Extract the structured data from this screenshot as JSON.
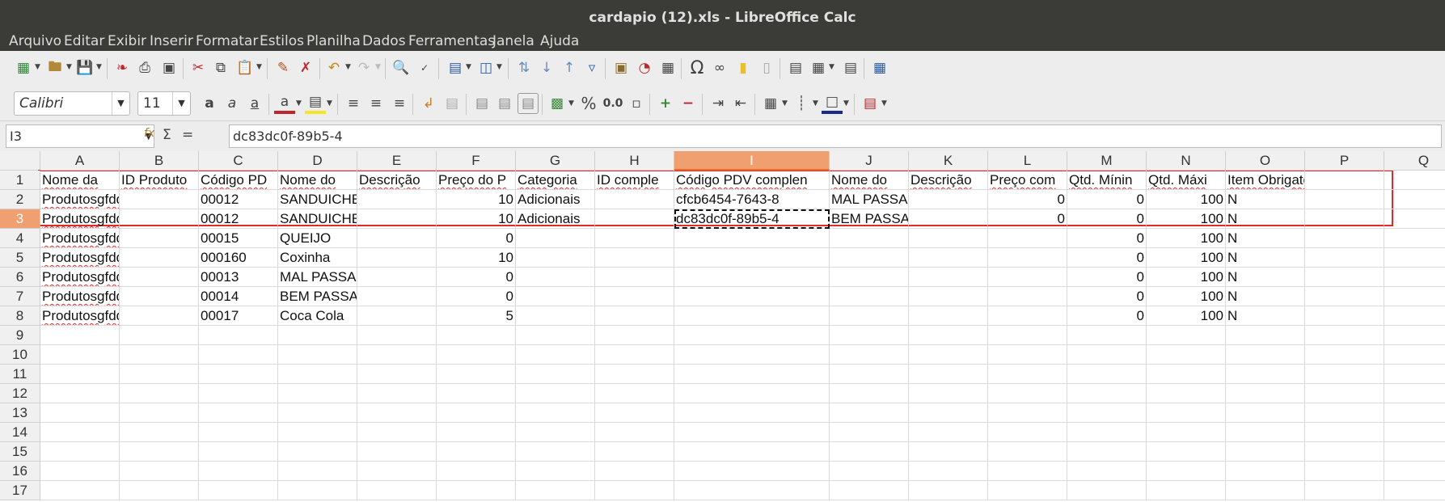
{
  "window": {
    "title": "cardapio (12).xls - LibreOffice Calc"
  },
  "menu": [
    "Arquivo",
    "Editar",
    "Exibir",
    "Inserir",
    "Formatar",
    "Estilos",
    "Planilha",
    "Dados",
    "Ferramentas",
    "Janela",
    "Ajuda"
  ],
  "toolbar": {
    "font_name": "Calibri",
    "font_size": "11",
    "percent_label": "%",
    "number_format_label": "0.0"
  },
  "formula_bar": {
    "cell_ref": "I3",
    "content": "dc83dc0f-89b5-4"
  },
  "sheet": {
    "columns": [
      "A",
      "B",
      "C",
      "D",
      "E",
      "F",
      "G",
      "H",
      "I",
      "J",
      "K",
      "L",
      "M",
      "N",
      "O",
      "P",
      "Q"
    ],
    "selected_column": "I",
    "selected_row": "3",
    "row_numbers": [
      "1",
      "2",
      "3",
      "4",
      "5",
      "6",
      "7",
      "8",
      "9",
      "10",
      "11",
      "12",
      "13",
      "14",
      "15",
      "16",
      "17"
    ],
    "rows": [
      [
        "Nome da",
        "ID Produto",
        "Código PD",
        "Nome do",
        "Descrição",
        "Preço do P",
        "Categoria",
        "ID comple",
        "Código PDV complen",
        "Nome do",
        "Descrição",
        "Preço com",
        "Qtd. Mínin",
        "Qtd. Máxi",
        "Item Obrigatorio",
        "",
        ""
      ],
      [
        "Produtosgfddf",
        "",
        "00012",
        "SANDUICHE",
        "",
        "10",
        "Adicionais",
        "",
        "cfcb6454-7643-8",
        "MAL PASSADA",
        "",
        "0",
        "0",
        "100",
        "N",
        "",
        ""
      ],
      [
        "Produtosgfddf",
        "",
        "00012",
        "SANDUICHE",
        "",
        "10",
        "Adicionais",
        "",
        "dc83dc0f-89b5-4",
        "BEM PASSADA",
        "",
        "0",
        "0",
        "100",
        "N",
        "",
        ""
      ],
      [
        "Produtosgfddf",
        "",
        "00015",
        "QUEIJO",
        "",
        "0",
        "",
        "",
        "",
        "",
        "",
        "",
        "0",
        "100",
        "N",
        "",
        ""
      ],
      [
        "Produtosgfddf",
        "",
        "000160",
        "Coxinha",
        "",
        "10",
        "",
        "",
        "",
        "",
        "",
        "",
        "0",
        "100",
        "N",
        "",
        ""
      ],
      [
        "Produtosgfddf",
        "",
        "00013",
        "MAL PASSADA",
        "",
        "0",
        "",
        "",
        "",
        "",
        "",
        "",
        "0",
        "100",
        "N",
        "",
        ""
      ],
      [
        "Produtosgfddf",
        "",
        "00014",
        "BEM PASSADA",
        "",
        "0",
        "",
        "",
        "",
        "",
        "",
        "",
        "0",
        "100",
        "N",
        "",
        ""
      ],
      [
        "Produtosgfddf",
        "",
        "00017",
        "Coca Cola",
        "",
        "5",
        "",
        "",
        "",
        "",
        "",
        "",
        "0",
        "100",
        "N",
        "",
        ""
      ]
    ]
  }
}
